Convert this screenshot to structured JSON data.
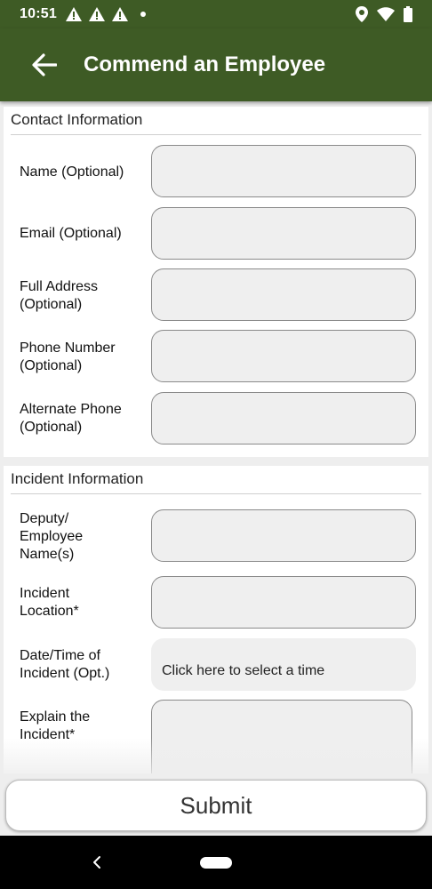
{
  "status_bar": {
    "time": "10:51",
    "left_icons": [
      "warning-icon",
      "warning-icon",
      "warning-icon",
      "dot-icon"
    ],
    "right_icons": [
      "location-icon",
      "wifi-icon",
      "battery-icon"
    ]
  },
  "app_bar": {
    "title": "Commend an Employee",
    "background_color": "#3e5b25"
  },
  "contact_section": {
    "header": "Contact Information",
    "fields": [
      {
        "label": "Name (Optional)",
        "value": ""
      },
      {
        "label": "Email (Optional)",
        "value": ""
      },
      {
        "label": "Full Address (Optional)",
        "value": ""
      },
      {
        "label": "Phone Number (Optional)",
        "value": ""
      },
      {
        "label": "Alternate Phone (Optional)",
        "value": ""
      }
    ]
  },
  "incident_section": {
    "header": "Incident Information",
    "fields": [
      {
        "label": "Deputy/ Employee Name(s)",
        "value": ""
      },
      {
        "label": "Incident Location*",
        "value": ""
      },
      {
        "label": "Date/Time of Incident (Opt.)",
        "button_text": "Click here to select a time"
      },
      {
        "label": "Explain the Incident*",
        "value": ""
      }
    ]
  },
  "submit": {
    "label": "Submit"
  }
}
